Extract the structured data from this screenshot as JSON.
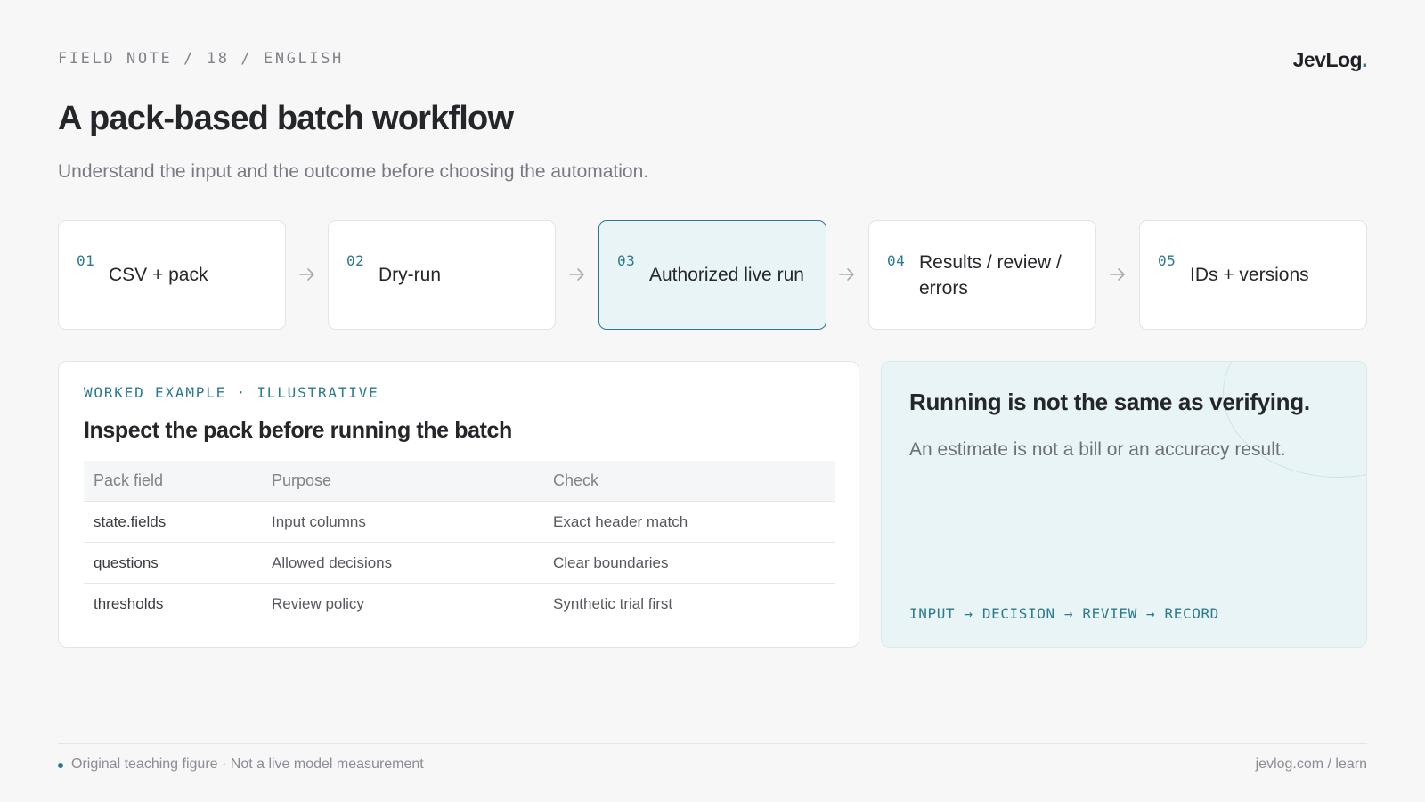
{
  "header": {
    "eyebrow": "FIELD NOTE / 18 / ENGLISH",
    "brand": "JevLog",
    "brand_dot": ".",
    "title": "A pack-based batch workflow",
    "subtitle": "Understand the input and the outcome before choosing the automation."
  },
  "steps": [
    {
      "num": "01",
      "label": "CSV + pack",
      "active": false
    },
    {
      "num": "02",
      "label": "Dry-run",
      "active": false
    },
    {
      "num": "03",
      "label": "Authorized live run",
      "active": true
    },
    {
      "num": "04",
      "label": "Results / review / errors",
      "active": false
    },
    {
      "num": "05",
      "label": "IDs + versions",
      "active": false
    }
  ],
  "example": {
    "tag": "WORKED EXAMPLE · ILLUSTRATIVE",
    "heading": "Inspect the pack before running the batch",
    "columns": [
      "Pack field",
      "Purpose",
      "Check"
    ],
    "rows": [
      [
        "state.fields",
        "Input columns",
        "Exact header match"
      ],
      [
        "questions",
        "Allowed decisions",
        "Clear boundaries"
      ],
      [
        "thresholds",
        "Review policy",
        "Synthetic trial first"
      ]
    ]
  },
  "callout": {
    "claim": "Running is not the same as verifying.",
    "note": "An estimate is not a bill or an accuracy result.",
    "flow": "INPUT → DECISION → REVIEW → RECORD"
  },
  "footer": {
    "left": "Original teaching figure · Not a live model measurement",
    "right": "jevlog.com / learn"
  },
  "colors": {
    "accent": "#2b7a8c",
    "active_fill": "#e8f4f6",
    "page_bg": "#f7f7f8"
  },
  "icons": {
    "step_arrow": "arrow-right-icon",
    "footer_bullet": "dot-icon"
  }
}
